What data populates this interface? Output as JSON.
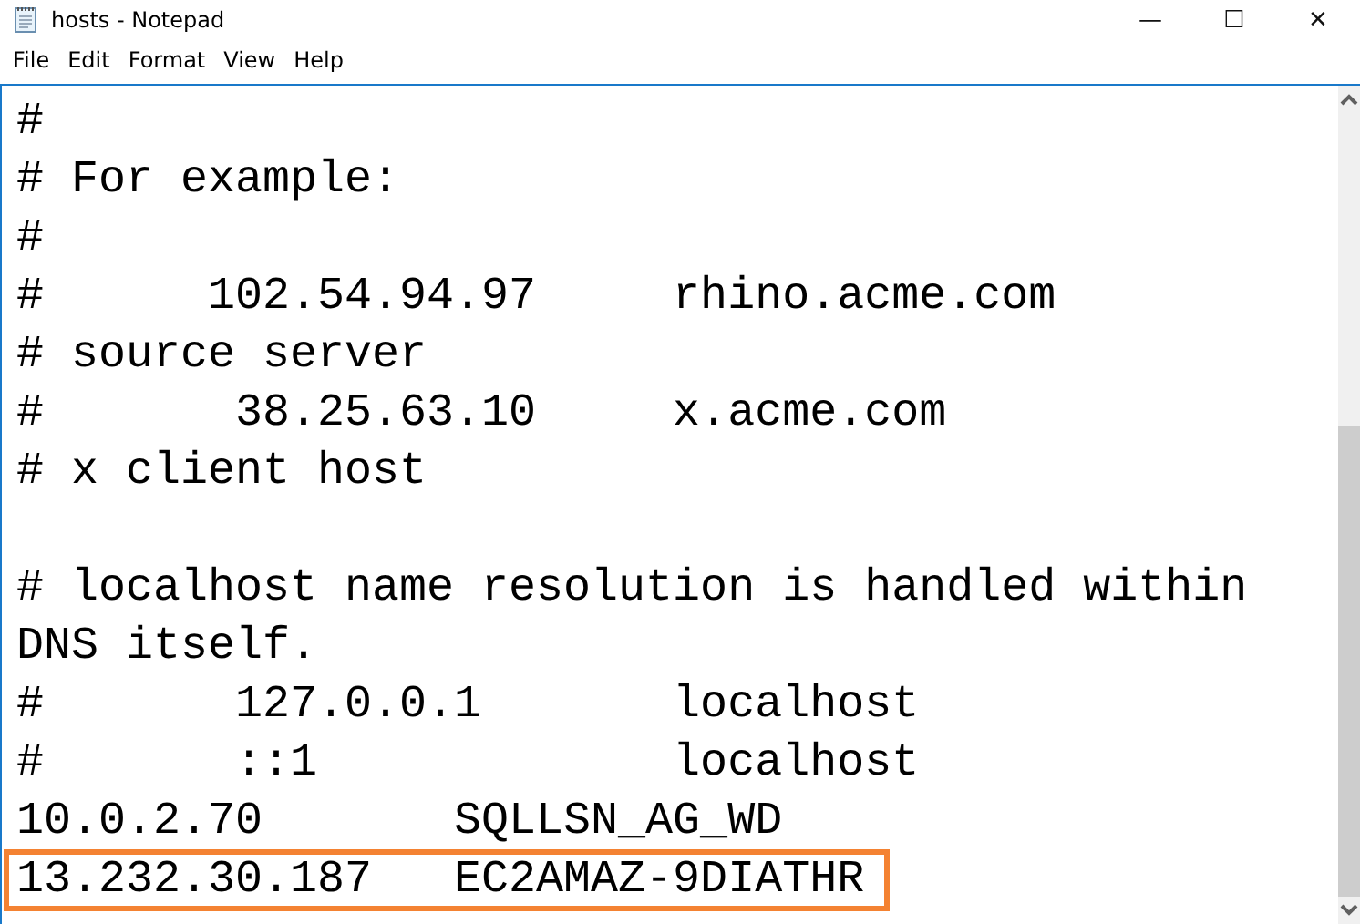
{
  "window": {
    "title": "hosts - Notepad",
    "controls": [
      "—",
      "☐",
      "✕"
    ]
  },
  "menu": [
    "File",
    "Edit",
    "Format",
    "View",
    "Help"
  ],
  "lines": [
    {
      "kind": "text",
      "text": "#",
      "highlighted": false
    },
    {
      "kind": "text",
      "text": "# For example:",
      "highlighted": false
    },
    {
      "kind": "text",
      "text": "#",
      "highlighted": false
    },
    {
      "kind": "text",
      "text": "#      102.54.94.97     rhino.acme.com",
      "highlighted": false
    },
    {
      "kind": "text",
      "text": "# source server",
      "highlighted": false
    },
    {
      "kind": "text",
      "text": "#       38.25.63.10     x.acme.com",
      "highlighted": false
    },
    {
      "kind": "text",
      "text": "# x client host",
      "highlighted": false
    },
    {
      "kind": "blank"
    },
    {
      "kind": "text",
      "text": "# localhost name resolution is handled within",
      "highlighted": false
    },
    {
      "kind": "text",
      "text": "DNS itself.",
      "highlighted": false
    },
    {
      "kind": "text",
      "text": "#       127.0.0.1       localhost",
      "highlighted": false
    },
    {
      "kind": "text",
      "text": "#       ::1             localhost",
      "highlighted": false
    },
    {
      "kind": "text",
      "text": "10.0.2.70       SQLLSN_AG_WD",
      "highlighted": false
    },
    {
      "kind": "text",
      "text": "13.232.30.187   EC2AMAZ-9DIATHR",
      "highlighted": true
    }
  ]
}
